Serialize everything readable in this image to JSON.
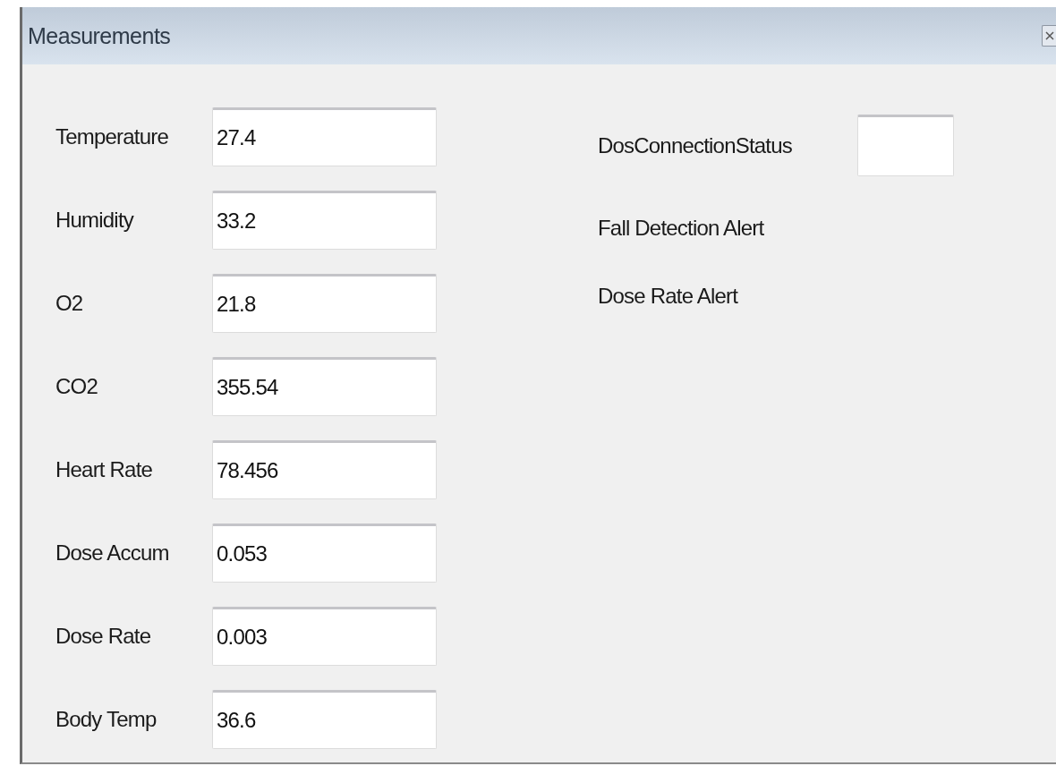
{
  "window": {
    "title": "Measurements"
  },
  "measurements": [
    {
      "label": "Temperature",
      "value": "27.4"
    },
    {
      "label": "Humidity",
      "value": "33.2"
    },
    {
      "label": "O2",
      "value": "21.8"
    },
    {
      "label": "CO2",
      "value": "355.54"
    },
    {
      "label": "Heart Rate",
      "value": "78.456"
    },
    {
      "label": "Dose Accum",
      "value": "0.053"
    },
    {
      "label": "Dose Rate",
      "value": "0.003"
    },
    {
      "label": "Body Temp",
      "value": "36.6"
    }
  ],
  "status": [
    {
      "kind": "field",
      "label": "DosConnectionStatus"
    },
    {
      "kind": "label",
      "label": "Fall Detection Alert"
    },
    {
      "kind": "label",
      "label": "Dose Rate Alert"
    }
  ]
}
